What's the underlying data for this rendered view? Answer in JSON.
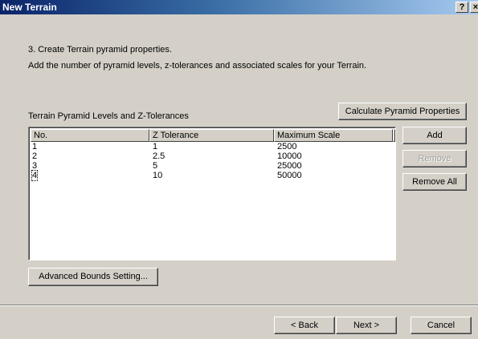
{
  "window": {
    "title": "New Terrain",
    "help_label": "?",
    "close_label": "×"
  },
  "step": {
    "heading": "3.  Create Terrain pyramid properties.",
    "description": "Add the number of pyramid levels, z-tolerances and associated scales for your Terrain."
  },
  "group_label": "Terrain Pyramid Levels and Z-Tolerances",
  "buttons": {
    "calculate": "Calculate Pyramid Properties",
    "add": "Add",
    "remove": "Remove",
    "remove_all": "Remove All",
    "advanced": "Advanced Bounds Setting...",
    "back": "< Back",
    "next": "Next >",
    "cancel": "Cancel"
  },
  "table": {
    "columns": [
      "No.",
      "Z Tolerance",
      "Maximum Scale"
    ],
    "rows": [
      [
        "1",
        "1",
        "2500"
      ],
      [
        "2",
        "2.5",
        "10000"
      ],
      [
        "3",
        "5",
        "25000"
      ],
      [
        "4",
        "10",
        "50000"
      ]
    ],
    "focused_row": 3
  }
}
